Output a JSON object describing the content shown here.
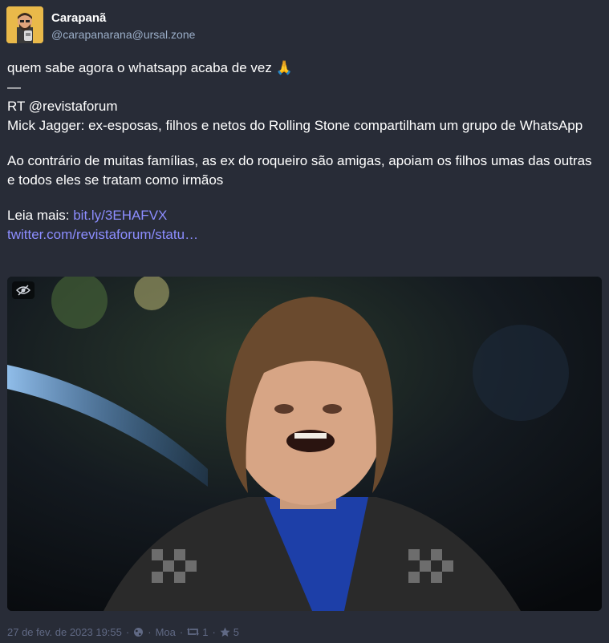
{
  "author": {
    "display_name": "Carapanã",
    "account": "@carapanarana@ursal.zone"
  },
  "post": {
    "line1": "quem sabe agora o whatsapp acaba de vez",
    "line1_emoji": "🙏",
    "divider": "—",
    "rt": "RT @revistaforum",
    "headline": "Mick Jagger: ex-esposas, filhos e netos do Rolling Stone compartilham um grupo de WhatsApp",
    "body": "Ao contrário de muitas famílias, as ex do roqueiro são amigas, apoiam os filhos umas das outras e todos eles se tratam como irmãos",
    "read_more_label": "Leia mais:",
    "link1": "bit.ly/3EHAFVX",
    "link2": "twitter.com/revistaforum/statu…"
  },
  "media": {
    "icon": "eye-slash-icon"
  },
  "footer": {
    "timestamp": "27 de fev. de 2023 19:55",
    "separator": "·",
    "visibility_icon": "globe-icon",
    "app": "Moa",
    "boost_icon": "retweet-icon",
    "boosts": "1",
    "fav_icon": "star-icon",
    "favourites": "5"
  },
  "colors": {
    "background": "#282c37",
    "link": "#8c8dff",
    "muted": "#606984",
    "account": "#9baec8"
  }
}
